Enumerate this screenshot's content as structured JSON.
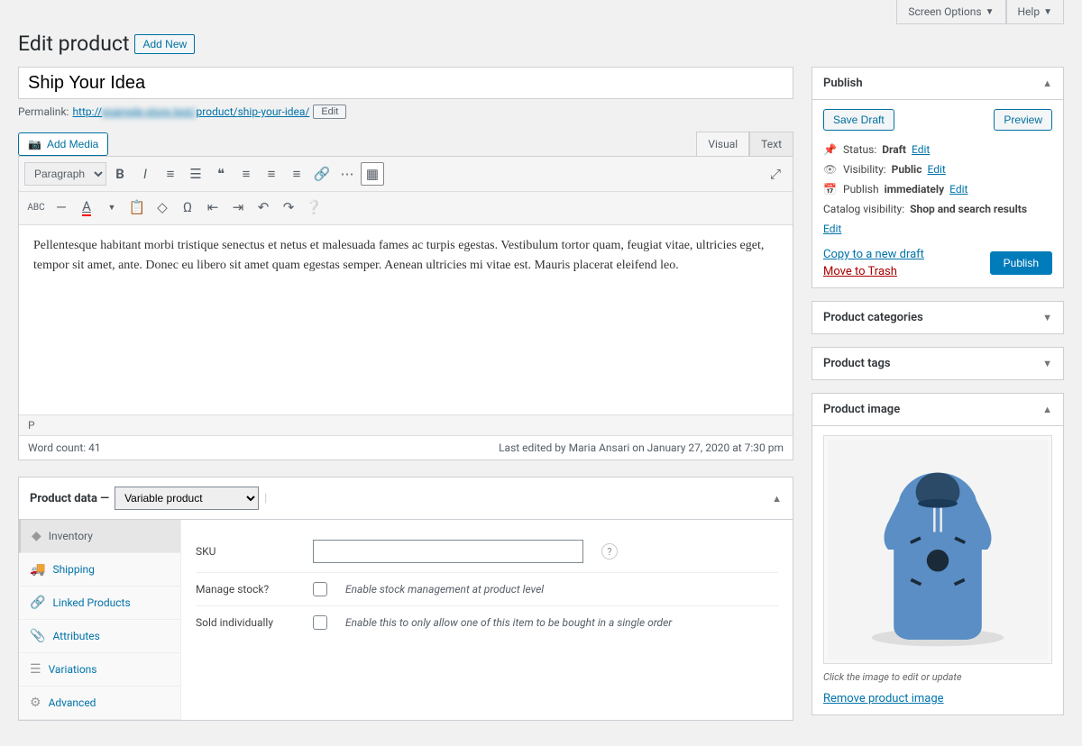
{
  "topbar": {
    "screen_options": "Screen Options",
    "help": "Help"
  },
  "header": {
    "title": "Edit product",
    "add_new": "Add New"
  },
  "post": {
    "title": "Ship Your Idea",
    "permalink_label": "Permalink:",
    "permalink_prefix": "http://",
    "permalink_mid": "example-store.test/",
    "permalink_path": "product/",
    "permalink_slug": "ship-your-idea/",
    "edit": "Edit"
  },
  "media_btn": "Add Media",
  "editor_tabs": {
    "visual": "Visual",
    "text": "Text"
  },
  "formats": "Paragraph",
  "content": "Pellentesque habitant morbi tristique senectus et netus et malesuada fames ac turpis egestas. Vestibulum tortor quam, feugiat vitae, ultricies eget, tempor sit amet, ante. Donec eu libero sit amet quam egestas semper. Aenean ultricies mi vitae est. Mauris placerat eleifend leo.",
  "status_path": "P",
  "wordcount": "Word count: 41",
  "last_edited": "Last edited by Maria Ansari on January 27, 2020 at 7:30 pm",
  "publish": {
    "title": "Publish",
    "save_draft": "Save Draft",
    "preview": "Preview",
    "status_label": "Status:",
    "status_value": "Draft",
    "visibility_label": "Visibility:",
    "visibility_value": "Public",
    "publish_label": "Publish",
    "publish_value": "immediately",
    "catalog_label": "Catalog visibility:",
    "catalog_value": "Shop and search results",
    "edit": "Edit",
    "copy": "Copy to a new draft",
    "trash": "Move to Trash",
    "publish_btn": "Publish"
  },
  "boxes": {
    "categories": "Product categories",
    "tags": "Product tags",
    "image": "Product image"
  },
  "image_box": {
    "hint": "Click the image to edit or update",
    "remove": "Remove product image"
  },
  "product_data": {
    "title": "Product data —",
    "type": "Variable product",
    "tabs": {
      "inventory": "Inventory",
      "shipping": "Shipping",
      "linked": "Linked Products",
      "attributes": "Attributes",
      "variations": "Variations",
      "advanced": "Advanced"
    },
    "sku_label": "SKU",
    "stock_label": "Manage stock?",
    "stock_hint": "Enable stock management at product level",
    "sold_label": "Sold individually",
    "sold_hint": "Enable this to only allow one of this item to be bought in a single order"
  }
}
